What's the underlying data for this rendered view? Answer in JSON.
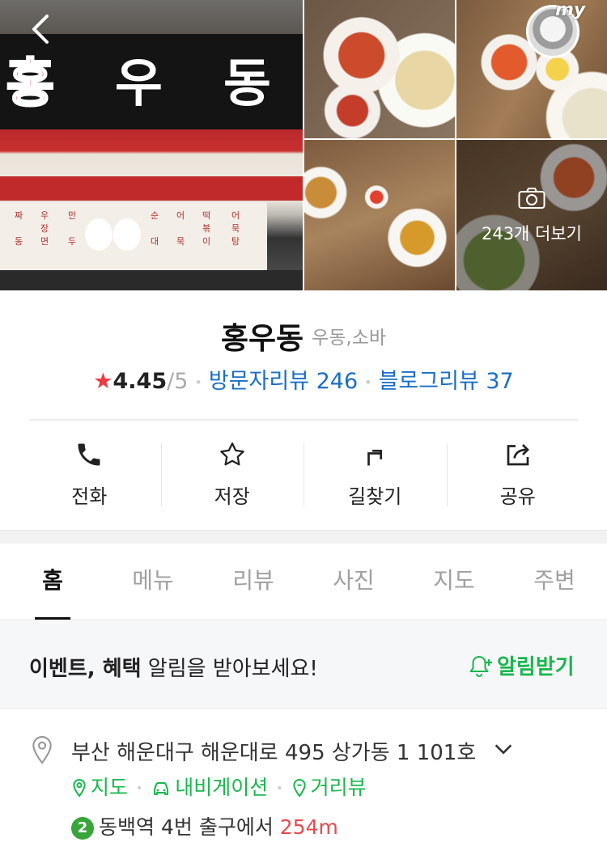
{
  "gallery": {
    "more_label": "243개 더보기",
    "my_tag": "my",
    "main_sign_text": "홍우동",
    "menu_board": [
      "우",
      "짜",
      "만",
      "장",
      "동",
      "면",
      "두",
      "순",
      "어",
      "떡",
      "대",
      "묵",
      "볶",
      "이",
      "어",
      "묵",
      "탕"
    ]
  },
  "place": {
    "name": "홍우동",
    "category": "우동,소바",
    "rating": "4.45",
    "rating_max": "/5",
    "visitor_review": "방문자리뷰 246",
    "blog_review": "블로그리뷰 37"
  },
  "actions": [
    {
      "label": "전화",
      "icon": "phone-icon"
    },
    {
      "label": "저장",
      "icon": "star-outline-icon"
    },
    {
      "label": "길찾기",
      "icon": "directions-icon"
    },
    {
      "label": "공유",
      "icon": "share-icon"
    }
  ],
  "tabs": [
    "홈",
    "메뉴",
    "리뷰",
    "사진",
    "지도",
    "주변"
  ],
  "active_tab": "홈",
  "notice": {
    "bold": "이벤트, 혜택",
    "text": " 알림을 받아보세요!",
    "button": "알림받기"
  },
  "address": {
    "text": "부산 해운대구 해운대로 495 상가동 1 101호",
    "links": [
      "지도",
      "내비게이션",
      "거리뷰"
    ],
    "subway_line": "2",
    "station": "동백역",
    "exit": " 4번 출구에서 ",
    "distance": "254m"
  },
  "colors": {
    "accent_green": "#19b74e",
    "link_blue": "#1a6ec5",
    "star_red": "#ee3a42",
    "distance_red": "#e54a4f",
    "line2_green": "#3aa53b"
  }
}
